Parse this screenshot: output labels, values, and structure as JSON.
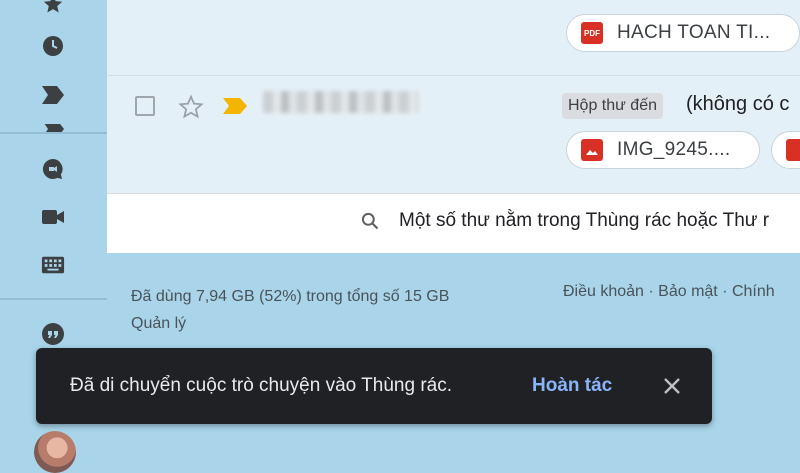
{
  "rail": {
    "icons": [
      "star-icon",
      "clock-icon",
      "label-icon",
      "chat-icon",
      "video-icon",
      "keyboard-icon",
      "quote-icon"
    ]
  },
  "mail": {
    "row1": {
      "attachment": {
        "type": "PDF",
        "name": "HACH TOAN TI..."
      }
    },
    "row2": {
      "label": "Hộp thư đến",
      "subject": "(không có c",
      "attachment": {
        "name": "IMG_9245...."
      }
    }
  },
  "search": {
    "text": "Một số thư nằm trong Thùng rác hoặc Thư r"
  },
  "footer": {
    "storage": "Đã dùng 7,94 GB (52%) trong tổng số 15 GB",
    "manage": "Quản lý",
    "links": "Điều khoản · Bảo mật · Chính"
  },
  "toast": {
    "message": "Đã di chuyển cuộc trò chuyện vào Thùng rác.",
    "undo": "Hoàn tác"
  },
  "colors": {
    "background": "#a9d4ea",
    "toast": "#202124",
    "undo": "#8ab4f8",
    "important": "#f4b400",
    "file_red": "#d93025"
  }
}
